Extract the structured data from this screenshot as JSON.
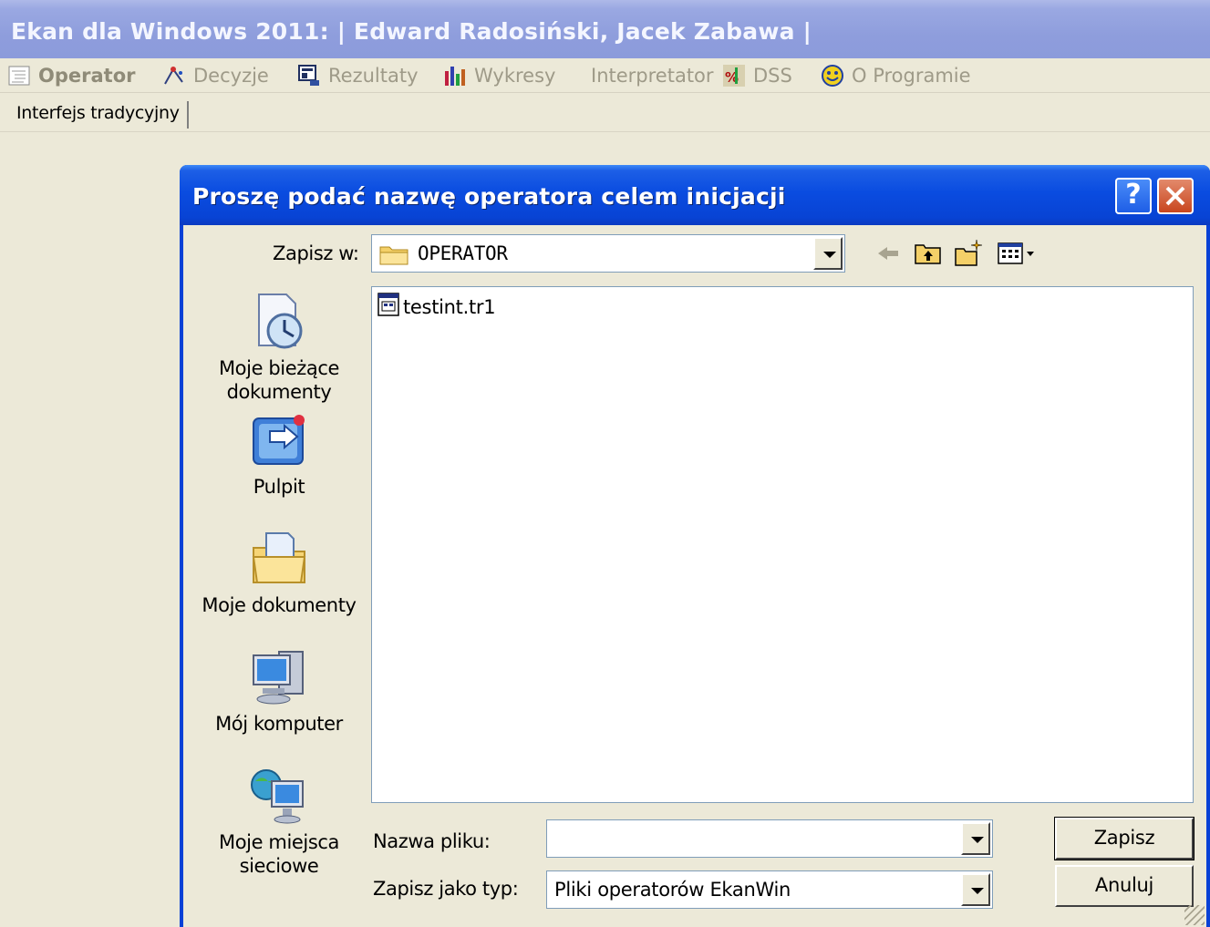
{
  "app": {
    "title": "Ekan dla Windows 2011:  | Edward Radosiński, Jacek Zabawa |"
  },
  "menu": {
    "items": [
      {
        "label": "Operator",
        "icon": "operator-icon"
      },
      {
        "label": "Decyzje",
        "icon": "decision-icon"
      },
      {
        "label": "Rezultaty",
        "icon": "results-icon"
      },
      {
        "label": "Wykresy",
        "icon": "charts-icon"
      },
      {
        "label": "Interpretator",
        "icon": ""
      },
      {
        "label": "DSS",
        "icon": "dss-icon"
      },
      {
        "label": "O Programie",
        "icon": "about-icon"
      }
    ]
  },
  "tabs": {
    "active": "Interfejs tradycyjny"
  },
  "dialog": {
    "title": "Proszę podać nazwę operatora celem inicjacji",
    "help_label": "?",
    "close_label": "✕",
    "save_in_label": "Zapisz w:",
    "save_in_value": "OPERATOR",
    "files": [
      {
        "name": "testint.tr1",
        "icon": "file-icon"
      }
    ],
    "places": [
      {
        "label_line1": "Moje bieżące",
        "label_line2": "dokumenty",
        "icon": "recent-documents-icon"
      },
      {
        "label_line1": "Pulpit",
        "label_line2": "",
        "icon": "desktop-icon"
      },
      {
        "label_line1": "Moje dokumenty",
        "label_line2": "",
        "icon": "my-documents-icon"
      },
      {
        "label_line1": "Mój komputer",
        "label_line2": "",
        "icon": "my-computer-icon"
      },
      {
        "label_line1": "Moje miejsca",
        "label_line2": "sieciowe",
        "icon": "network-places-icon"
      }
    ],
    "filename_label": "Nazwa pliku:",
    "filename_value": "",
    "filetype_label": "Zapisz jako typ:",
    "filetype_value": "Pliki operatorów EkanWin",
    "save_button": "Zapisz",
    "cancel_button": "Anuluj"
  }
}
